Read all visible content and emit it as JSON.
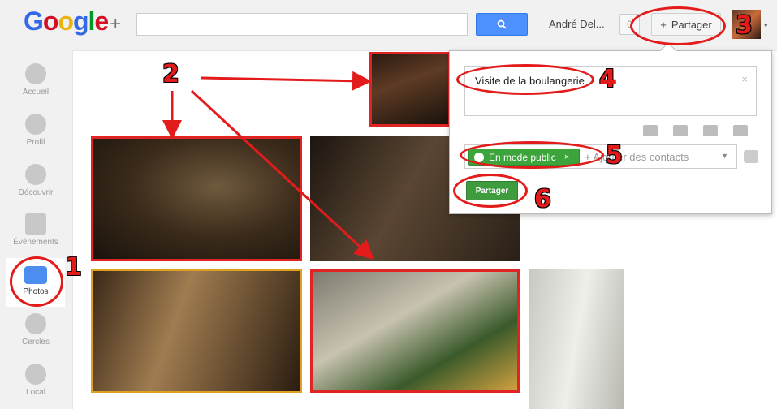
{
  "header": {
    "logo_letters": [
      "G",
      "o",
      "o",
      "g",
      "l",
      "e"
    ],
    "logo_plus": "+",
    "user_name": "André Del...",
    "notifications_count": "0",
    "share_button_label": "Partager",
    "search_placeholder": ""
  },
  "sidebar": {
    "items": [
      {
        "label": "Accueil",
        "icon": "home-icon"
      },
      {
        "label": "Profil",
        "icon": "profile-icon"
      },
      {
        "label": "Découvrir",
        "icon": "compass-icon"
      },
      {
        "label": "Événements",
        "icon": "calendar-icon"
      },
      {
        "label": "Photos",
        "icon": "camera-icon",
        "active": true
      },
      {
        "label": "Cercles",
        "icon": "circles-icon"
      },
      {
        "label": "Local",
        "icon": "location-pin-icon"
      }
    ]
  },
  "share_panel": {
    "post_text": "Visite de la boulangerie",
    "audience_chip": "En mode public",
    "audience_chip_remove": "×",
    "add_more_text": "+ Ajouter des contacts",
    "submit_label": "Partager",
    "close_symbol": "×"
  },
  "annotations": {
    "numbers": [
      "1",
      "2",
      "3",
      "4",
      "5",
      "6"
    ],
    "color": "#e31b1b"
  }
}
